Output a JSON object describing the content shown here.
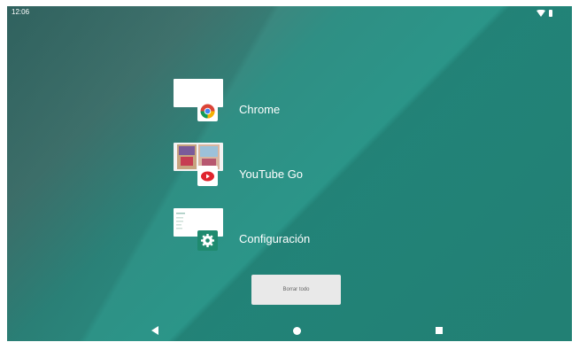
{
  "status_bar": {
    "time": "12:06"
  },
  "recents": [
    {
      "label": "Chrome",
      "icon": "chrome-icon"
    },
    {
      "label": "YouTube Go",
      "icon": "youtube-go-icon"
    },
    {
      "label": "Configuración",
      "icon": "settings-gear-icon"
    }
  ],
  "clear_all": {
    "label": "Borrar todo"
  },
  "colors": {
    "wallpaper_teal": "#2a978a",
    "wallpaper_dark": "#3f7672",
    "settings_green": "#1f8a6f",
    "youtube_red": "#e0242d"
  },
  "nav_bar": {
    "back_icon": "back-triangle-icon",
    "home_icon": "home-circle-icon",
    "recents_icon": "recents-square-icon"
  }
}
